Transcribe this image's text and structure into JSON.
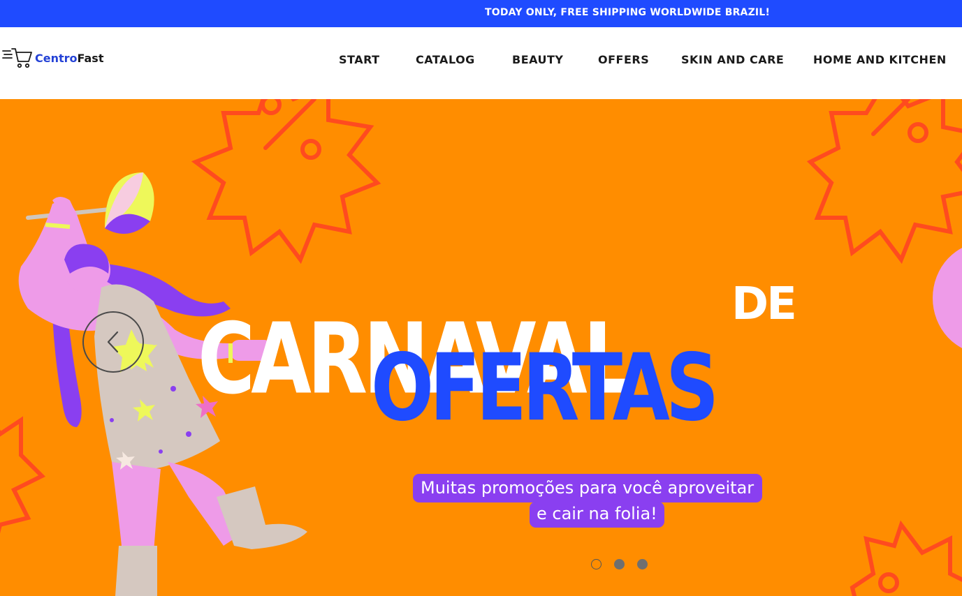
{
  "announcement": {
    "text": "TODAY ONLY, FREE SHIPPING WORLDWIDE BRAZIL!"
  },
  "header": {
    "logo": {
      "part1": "Centro",
      "part2": "Fast",
      "icon": "shopping-cart-icon"
    },
    "nav": [
      {
        "label": "START"
      },
      {
        "label": "CATALOG"
      },
      {
        "label": "BEAUTY"
      },
      {
        "label": "OFFERS"
      },
      {
        "label": "SKIN AND CARE"
      },
      {
        "label": "HOME AND KITCHEN"
      }
    ]
  },
  "hero": {
    "headline_line1": "CARNAVAL",
    "headline_de": "DE",
    "headline_line2": "OFERTAS",
    "promo_line1": "Muitas promoções para você aproveitar",
    "promo_line2": "e cair na folia!",
    "prev_icon": "chevron-left-icon",
    "slide_count": 3,
    "active_slide": 1
  },
  "colors": {
    "announcement_bg": "#1f4bff",
    "hero_bg": "#ff8d00",
    "headline_blue": "#1f4bff",
    "promo_purple": "#8a3ff0",
    "pink": "#ee9be8",
    "burst_red": "#ff4b1f"
  }
}
